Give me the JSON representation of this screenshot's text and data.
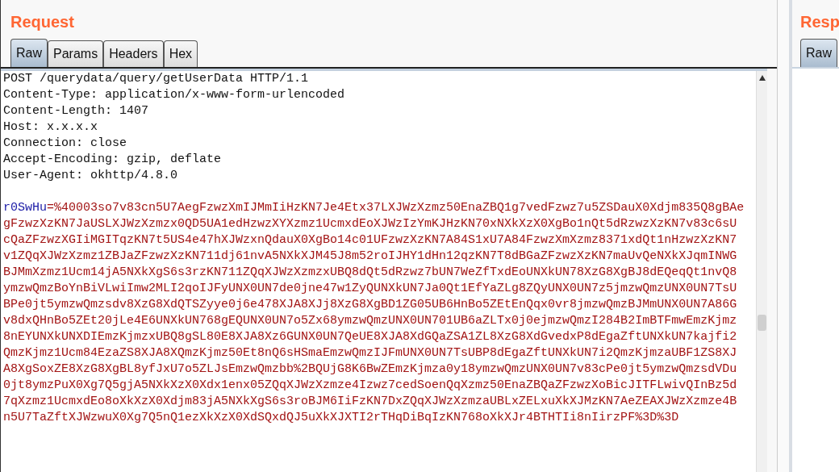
{
  "request": {
    "title": "Request",
    "tabs": [
      {
        "label": "Raw",
        "selected": true
      },
      {
        "label": "Params",
        "selected": false
      },
      {
        "label": "Headers",
        "selected": false
      },
      {
        "label": "Hex",
        "selected": false
      }
    ],
    "header_lines": [
      "POST /querydata/query/getUserData HTTP/1.1",
      "Content-Type: application/x-www-form-urlencoded",
      "Content-Length: 1407",
      "Host: x.x.x.x",
      "Connection: close",
      "Accept-Encoding: gzip, deflate",
      "User-Agent: okhttp/4.8.0"
    ],
    "body": {
      "name": "r0SwHu",
      "value_lines": [
        "=%40003so7v83cn5U7AegFzwzXmIJMmIiHzKN7Je4Etx37LXJWzXzmz50EnaZBQ1g7vedFzwz7u5ZSDauX0Xdjm835Q8gBAe",
        "gFzwzXzKN7JaUSLXJWzXzmzx0QD5UA1edHzwzXYXzmz1UcmxdEoXJWzIzYmKJHzKN70xNXkXzX0XgBo1nQt5dRzwzXzKN7v83c6sU",
        "cQaZFzwzXGIiMGITqzKN7t5US4e47hXJWzxnQdauX0XgBo14c01UFzwzXzKN7A84S1xU7A84FzwzXmXzmz8371xdQt1nHzwzXzKN7",
        "v1ZQqXJWzXzmz1ZBJaZFzwzXzKN711dj61nvA5NXkXJM45J8m52roIJHY1dHn12qzKN7T8dBGaZFzwzXzKN7maUvQeNXkXJqmINWG",
        "BJMmXzmz1Ucm14jA5NXkXgS6s3rzKN711ZQqXJWzXzmzxUBQ8dQt5dRzwz7bUN7WeZfTxdEoUNXkUN78XzG8XgBJ8dEQeqQt1nvQ8",
        "ymzwQmzBoYnBiVLwiImw2MLI2qoIJFyUNX0UN7de0jne47w1ZyQUNXkUN7Ja0Qt1EfYaZLg8ZQyUNX0UN7z5jmzwQmzUNX0UN7TsU",
        "BPe0jt5ymzwQmzsdv8XzG8XdQTSZyye0j6e478XJA8XJj8XzG8XgBD1ZG05UB6HnBo5ZEtEnQqx0vr8jmzwQmzBJMmUNX0UN7A86G",
        "v8dxQHnBo5ZEt20jLe4E6UNXkUN768gEQUNX0UN7o5Zx68ymzwQmzUNX0UN701UB6aZLTx0j0ejmzwQmzI284B2ImBTFmwEmzKjmz",
        "8nEYUNXkUNXDIEmzKjmzxUBQ8gSL80E8XJA8Xz6GUNX0UN7QeUE8XJA8XdGQaZSA1ZL8XzG8XdGvedxP8dEgaZftUNXkUN7kajfi2",
        "QmzKjmz1Ucm84EzaZS8XJA8XQmzKjmz50Et8nQ6sHSmaEmzwQmzIJFmUNX0UN7TsUBP8dEgaZftUNXkUN7i2QmzKjmzaUBF1ZS8XJ",
        "A8XgSoxZE8XzG8XgBL8yfJxU7o5ZLJsEmzwQmzbb%2BQUjG8K6BwZEmzKjmza0y18ymzwQmzUNX0UN7v83cPe0jt5ymzwQmzsdVDu",
        "0jt8ymzPuX0Xg7Q5gjA5NXkXzX0Xdx1enx05ZQqXJWzXzmze4Izwz7cedSoenQqXzmz50EnaZBQaZFzwzXoBicJITFLwivQInBz5d",
        "7qXzmz1UcmxdEo8oXkXzX0Xdjm83jA5NXkXgS6s3roBJM6IiFzKN7DxZQqXJWzXzmzaUBLxZELxuXkXJMzKN7AeZEAXJWzXzmze4B",
        "n5U7TaZftXJWzwuX0Xg7Q5nQ1ezXkXzX0XdSQxdQJ5uXkXJXTI2rTHqDiBqIzKN768oXkXJr4BTHTIi8nIirzPF%3D%3D"
      ]
    }
  },
  "response": {
    "title": "Resp",
    "tabs": [
      {
        "label": "Raw",
        "selected": true
      }
    ]
  }
}
